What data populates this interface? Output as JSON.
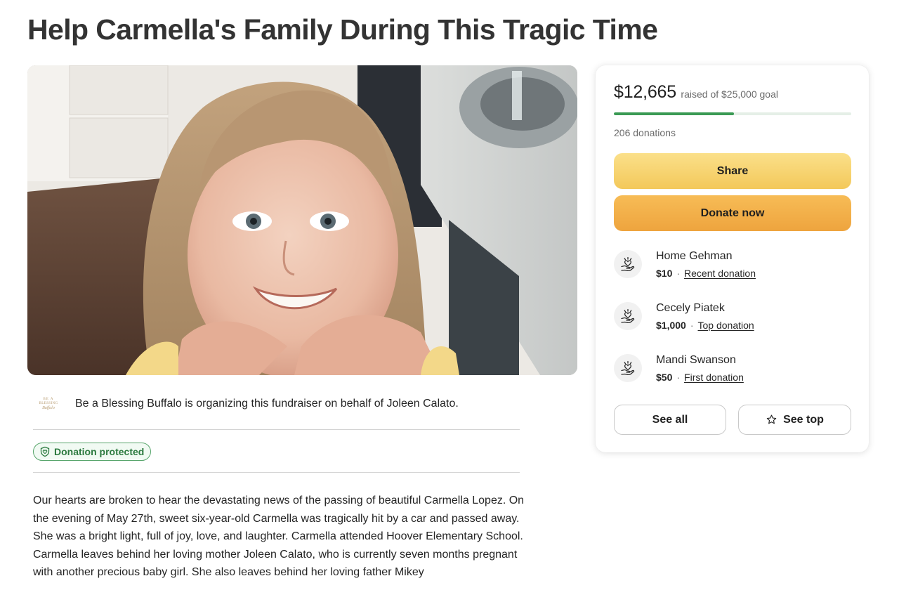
{
  "campaign": {
    "title": "Help Carmella's Family During This Tragic Time"
  },
  "organizer": {
    "logo_lines": [
      "BE A",
      "BLESSING",
      "Buffalo"
    ],
    "text": "Be a Blessing Buffalo is organizing this fundraiser on behalf of Joleen Calato."
  },
  "badge": {
    "label": "Donation protected",
    "color": "#2c7a3f"
  },
  "story": {
    "paragraphs": [
      "Our hearts are broken to hear the devastating news of the passing of beautiful Carmella Lopez. On the evening of May 27th, sweet six-year-old Carmella was tragically hit by a car and passed away. She was a bright light, full of joy, love, and laughter. Carmella attended Hoover Elementary School.",
      "Carmella leaves behind her loving mother Joleen Calato, who is currently seven months pregnant with another precious baby girl. She also leaves behind her loving father Mikey"
    ]
  },
  "summary": {
    "raised": "$12,665",
    "goal_text": "raised of $25,000 goal",
    "progress_fraction": 0.5066,
    "donations": "206 donations"
  },
  "actions": {
    "share_label": "Share",
    "donate_label": "Donate now",
    "see_all_label": "See all",
    "see_top_label": "See top"
  },
  "donors": [
    {
      "name": "Home Gehman",
      "amount": "$10",
      "type": "Recent donation"
    },
    {
      "name": "Cecely Piatek",
      "amount": "$1,000",
      "type": "Top donation"
    },
    {
      "name": "Mandi Swanson",
      "amount": "$50",
      "type": "First donation"
    }
  ],
  "icons": {
    "badge": "shield-heart-icon",
    "donor": "heart-hand-icon",
    "see_top": "star-outline-icon"
  },
  "colors": {
    "progress": "#3a9a54",
    "share_button": "#f3c85a",
    "donate_button": "#eea43e"
  }
}
